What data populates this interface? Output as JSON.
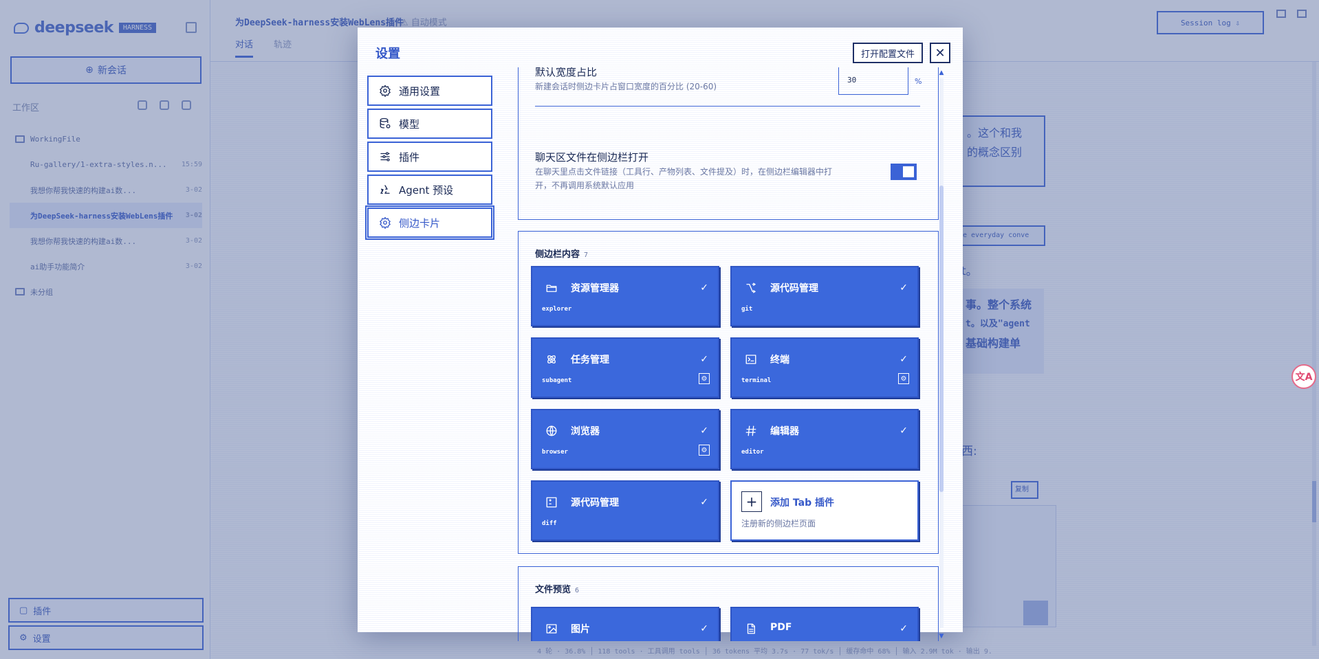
{
  "app": {
    "brand": "deepseek",
    "badge": "HARNESS",
    "new_chat": "新会话",
    "workspace_label": "工作区",
    "tree": [
      {
        "title": "WorkingFile",
        "date": "",
        "kind": "folder"
      },
      {
        "title": "Ru-gallery/1-extra-styles.n...",
        "date": "15:59",
        "kind": "file"
      },
      {
        "title": "我想你帮我快速的构建ai数...",
        "date": "3-02",
        "kind": "file"
      },
      {
        "title": "为DeepSeek-harness安装WebLens插件",
        "date": "3-02",
        "kind": "file",
        "active": true
      },
      {
        "title": "我想你帮我快速的构建ai数...",
        "date": "3-02",
        "kind": "file"
      },
      {
        "title": "ai助手功能简介",
        "date": "3-02",
        "kind": "file"
      },
      {
        "title": "未分组",
        "date": "",
        "kind": "folder"
      }
    ],
    "bottom_buttons": [
      "插件",
      "设置"
    ],
    "top_title": "为DeepSeek-harness安装WebLens插件",
    "top_mode": "自动模式",
    "top_tabs": [
      "对话",
      "轨迹"
    ],
    "session_log": "Session log",
    "bg_snippets": [
      "。这个和我",
      "的概念区别",
      "e everyday conve",
      "t。",
      "事。整个系统",
      "t。以及\"agent",
      "基础构建单",
      "西:",
      "复制"
    ],
    "status": "4 轮 · 36.8% │ 118 tools · 工具调用 tools │ 36 tokens 平均 3.7s · 77 tok/s │ 缓存命中 68% │ 输入 2.9M tok · 输出 9."
  },
  "modal": {
    "title": "设置",
    "open_config": "打开配置文件",
    "nav": [
      {
        "label": "通用设置",
        "icon": "gear-icon"
      },
      {
        "label": "模型",
        "icon": "database-icon"
      },
      {
        "label": "插件",
        "icon": "sliders-icon"
      },
      {
        "label": "Agent 预设",
        "icon": "recycle-icon"
      },
      {
        "label": "侧边卡片",
        "icon": "gear-icon",
        "active": true
      }
    ],
    "general": {
      "width_label": "默认宽度占比",
      "width_desc": "新建会话时侧边卡片占窗口宽度的百分比 (20-60)",
      "width_value": "30",
      "width_unit": "%",
      "open_label": "聊天区文件在侧边栏打开",
      "open_desc_1": "在聊天里点击文件链接（工具行、产物列表、文件提及）时，在侧边栏编辑器中打",
      "open_desc_2": "开，不再调用系统默认应用",
      "open_enabled": true
    },
    "sidebar_section": {
      "title": "侧边栏内容",
      "count": "7",
      "cards": [
        {
          "title": "资源管理器",
          "id": "explorer",
          "icon": "folder-icon",
          "gear": false
        },
        {
          "title": "源代码管理",
          "id": "git",
          "icon": "git-branch-icon",
          "gear": false
        },
        {
          "title": "任务管理",
          "id": "subagent",
          "icon": "atom-icon",
          "gear": true
        },
        {
          "title": "终端",
          "id": "terminal",
          "icon": "terminal-icon",
          "gear": true
        },
        {
          "title": "浏览器",
          "id": "browser",
          "icon": "globe-icon",
          "gear": true
        },
        {
          "title": "编辑器",
          "id": "editor",
          "icon": "hash-icon",
          "gear": false
        },
        {
          "title": "源代码管理",
          "id": "diff",
          "icon": "diff-icon",
          "gear": false
        }
      ],
      "add_title": "添加 Tab 插件",
      "add_desc": "注册新的侧边栏页面"
    },
    "preview_section": {
      "title": "文件预览",
      "count": "6",
      "cards": [
        {
          "title": "图片",
          "icon": "image-icon"
        },
        {
          "title": "PDF",
          "icon": "file-icon"
        }
      ]
    }
  }
}
